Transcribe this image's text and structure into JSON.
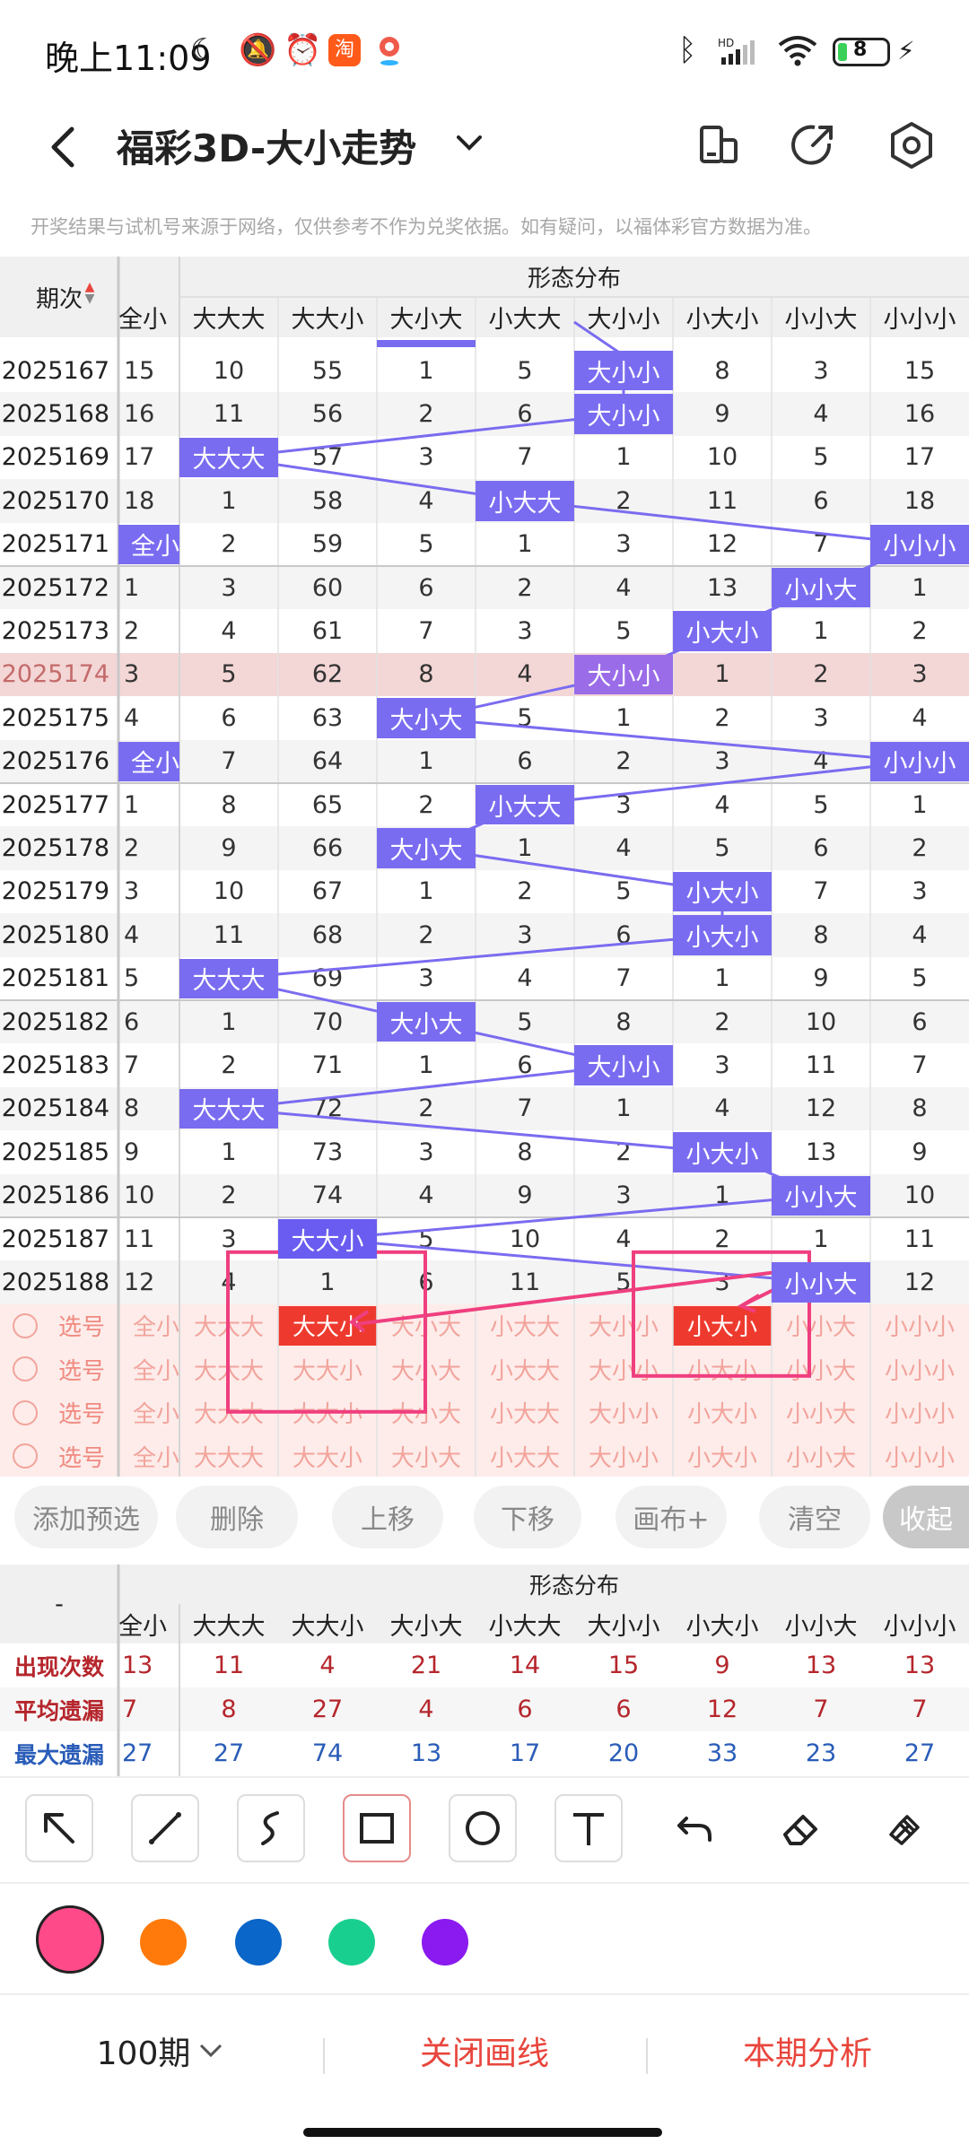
{
  "status": {
    "time": "晚上11:09",
    "battery": "8"
  },
  "header": {
    "title": "福彩3D-大小走势"
  },
  "notice": "开奖结果与试机号来源于网络，仅供参考不作为兑奖依据。如有疑问，以福体彩官方数据为准。",
  "table": {
    "issue_header": "期次",
    "group_header": "形态分布",
    "first_col_header": "全小",
    "columns": [
      "大大大",
      "大大小",
      "大小大",
      "小大大",
      "大小小",
      "小大小",
      "小小大",
      "小小小"
    ],
    "rows": [
      {
        "issue": "2025167",
        "first": "15",
        "cells": [
          "10",
          "55",
          "1",
          "5",
          "大小小",
          "8",
          "3",
          "15"
        ]
      },
      {
        "issue": "2025168",
        "first": "16",
        "cells": [
          "11",
          "56",
          "2",
          "6",
          "大小小",
          "9",
          "4",
          "16"
        ]
      },
      {
        "issue": "2025169",
        "first": "17",
        "cells": [
          "大大大",
          "57",
          "3",
          "7",
          "1",
          "10",
          "5",
          "17"
        ]
      },
      {
        "issue": "2025170",
        "first": "18",
        "cells": [
          "1",
          "58",
          "4",
          "小大大",
          "2",
          "11",
          "6",
          "18"
        ]
      },
      {
        "issue": "2025171",
        "first": "全小",
        "cells": [
          "2",
          "59",
          "5",
          "1",
          "3",
          "12",
          "7",
          "小小小"
        ]
      },
      {
        "issue": "2025172",
        "first": "1",
        "cells": [
          "3",
          "60",
          "6",
          "2",
          "4",
          "13",
          "小小大",
          "1"
        ]
      },
      {
        "issue": "2025173",
        "first": "2",
        "cells": [
          "4",
          "61",
          "7",
          "3",
          "5",
          "小大小",
          "1",
          "2"
        ]
      },
      {
        "issue": "2025174",
        "first": "3",
        "cells": [
          "5",
          "62",
          "8",
          "4",
          "大小小",
          "1",
          "2",
          "3"
        ]
      },
      {
        "issue": "2025175",
        "first": "4",
        "cells": [
          "6",
          "63",
          "大小大",
          "5",
          "1",
          "2",
          "3",
          "4"
        ]
      },
      {
        "issue": "2025176",
        "first": "全小",
        "cells": [
          "7",
          "64",
          "1",
          "6",
          "2",
          "3",
          "4",
          "小小小"
        ]
      },
      {
        "issue": "2025177",
        "first": "1",
        "cells": [
          "8",
          "65",
          "2",
          "小大大",
          "3",
          "4",
          "5",
          "1"
        ]
      },
      {
        "issue": "2025178",
        "first": "2",
        "cells": [
          "9",
          "66",
          "大小大",
          "1",
          "4",
          "5",
          "6",
          "2"
        ]
      },
      {
        "issue": "2025179",
        "first": "3",
        "cells": [
          "10",
          "67",
          "1",
          "2",
          "5",
          "小大小",
          "7",
          "3"
        ]
      },
      {
        "issue": "2025180",
        "first": "4",
        "cells": [
          "11",
          "68",
          "2",
          "3",
          "6",
          "小大小",
          "8",
          "4"
        ]
      },
      {
        "issue": "2025181",
        "first": "5",
        "cells": [
          "大大大",
          "69",
          "3",
          "4",
          "7",
          "1",
          "9",
          "5"
        ]
      },
      {
        "issue": "2025182",
        "first": "6",
        "cells": [
          "1",
          "70",
          "大小大",
          "5",
          "8",
          "2",
          "10",
          "6"
        ]
      },
      {
        "issue": "2025183",
        "first": "7",
        "cells": [
          "2",
          "71",
          "1",
          "6",
          "大小小",
          "3",
          "11",
          "7"
        ]
      },
      {
        "issue": "2025184",
        "first": "8",
        "cells": [
          "大大大",
          "72",
          "2",
          "7",
          "1",
          "4",
          "12",
          "8"
        ]
      },
      {
        "issue": "2025185",
        "first": "9",
        "cells": [
          "1",
          "73",
          "3",
          "8",
          "2",
          "小大小",
          "13",
          "9"
        ]
      },
      {
        "issue": "2025186",
        "first": "10",
        "cells": [
          "2",
          "74",
          "4",
          "9",
          "3",
          "1",
          "小小大",
          "10"
        ]
      },
      {
        "issue": "2025187",
        "first": "11",
        "cells": [
          "3",
          "大大小",
          "5",
          "10",
          "4",
          "2",
          "1",
          "11"
        ]
      },
      {
        "issue": "2025188",
        "first": "12",
        "cells": [
          "4",
          "1",
          "6",
          "11",
          "5",
          "3",
          "小小大",
          "12"
        ]
      }
    ],
    "select_rows": [
      {
        "label": "选号",
        "first": "全小",
        "cells": [
          "大大大",
          "大大小",
          "大小大",
          "小大大",
          "大小小",
          "小大小",
          "小小大",
          "小小小"
        ]
      },
      {
        "label": "选号",
        "first": "全小",
        "cells": [
          "大大大",
          "大大小",
          "大小大",
          "小大大",
          "大小小",
          "小大小",
          "小小大",
          "小小小"
        ]
      },
      {
        "label": "选号",
        "first": "全小",
        "cells": [
          "大大大",
          "大大小",
          "大小大",
          "小大大",
          "大小小",
          "小大小",
          "小小大",
          "小小小"
        ]
      },
      {
        "label": "选号",
        "first": "全小",
        "cells": [
          "大大大",
          "大大小",
          "大小大",
          "小大大",
          "大小小",
          "小大小",
          "小小大",
          "小小小"
        ]
      }
    ],
    "selected_picks": [
      "大大小",
      "小大小"
    ]
  },
  "actions": [
    "添加预选",
    "删除",
    "上移",
    "下移",
    "画布+",
    "清空",
    "收起"
  ],
  "stats": {
    "corner": "-",
    "group_header": "形态分布",
    "first_col_header": "全小",
    "columns": [
      "大大大",
      "大大小",
      "大小大",
      "小大大",
      "大小小",
      "小大小",
      "小小大",
      "小小小"
    ],
    "rows": [
      {
        "label": "出现次数",
        "first": "13",
        "values": [
          "11",
          "4",
          "21",
          "14",
          "15",
          "9",
          "13",
          "13"
        ]
      },
      {
        "label": "平均遗漏",
        "first": "7",
        "values": [
          "8",
          "27",
          "4",
          "6",
          "6",
          "12",
          "7",
          "7"
        ]
      },
      {
        "label": "最大遗漏",
        "first": "27",
        "values": [
          "27",
          "74",
          "13",
          "17",
          "20",
          "33",
          "23",
          "27"
        ]
      }
    ]
  },
  "tools": [
    "arrow-tool",
    "line-tool",
    "curve-tool",
    "rectangle-tool",
    "circle-tool",
    "text-tool",
    "undo-tool",
    "eraser-tool",
    "clear-tool"
  ],
  "colors": [
    "#ff4a8a",
    "#ff7a0a",
    "#0a66c8",
    "#19cf8f",
    "#8a1aef"
  ],
  "bottom": {
    "period": "100期",
    "close_draw": "关闭画线",
    "analysis": "本期分析"
  }
}
